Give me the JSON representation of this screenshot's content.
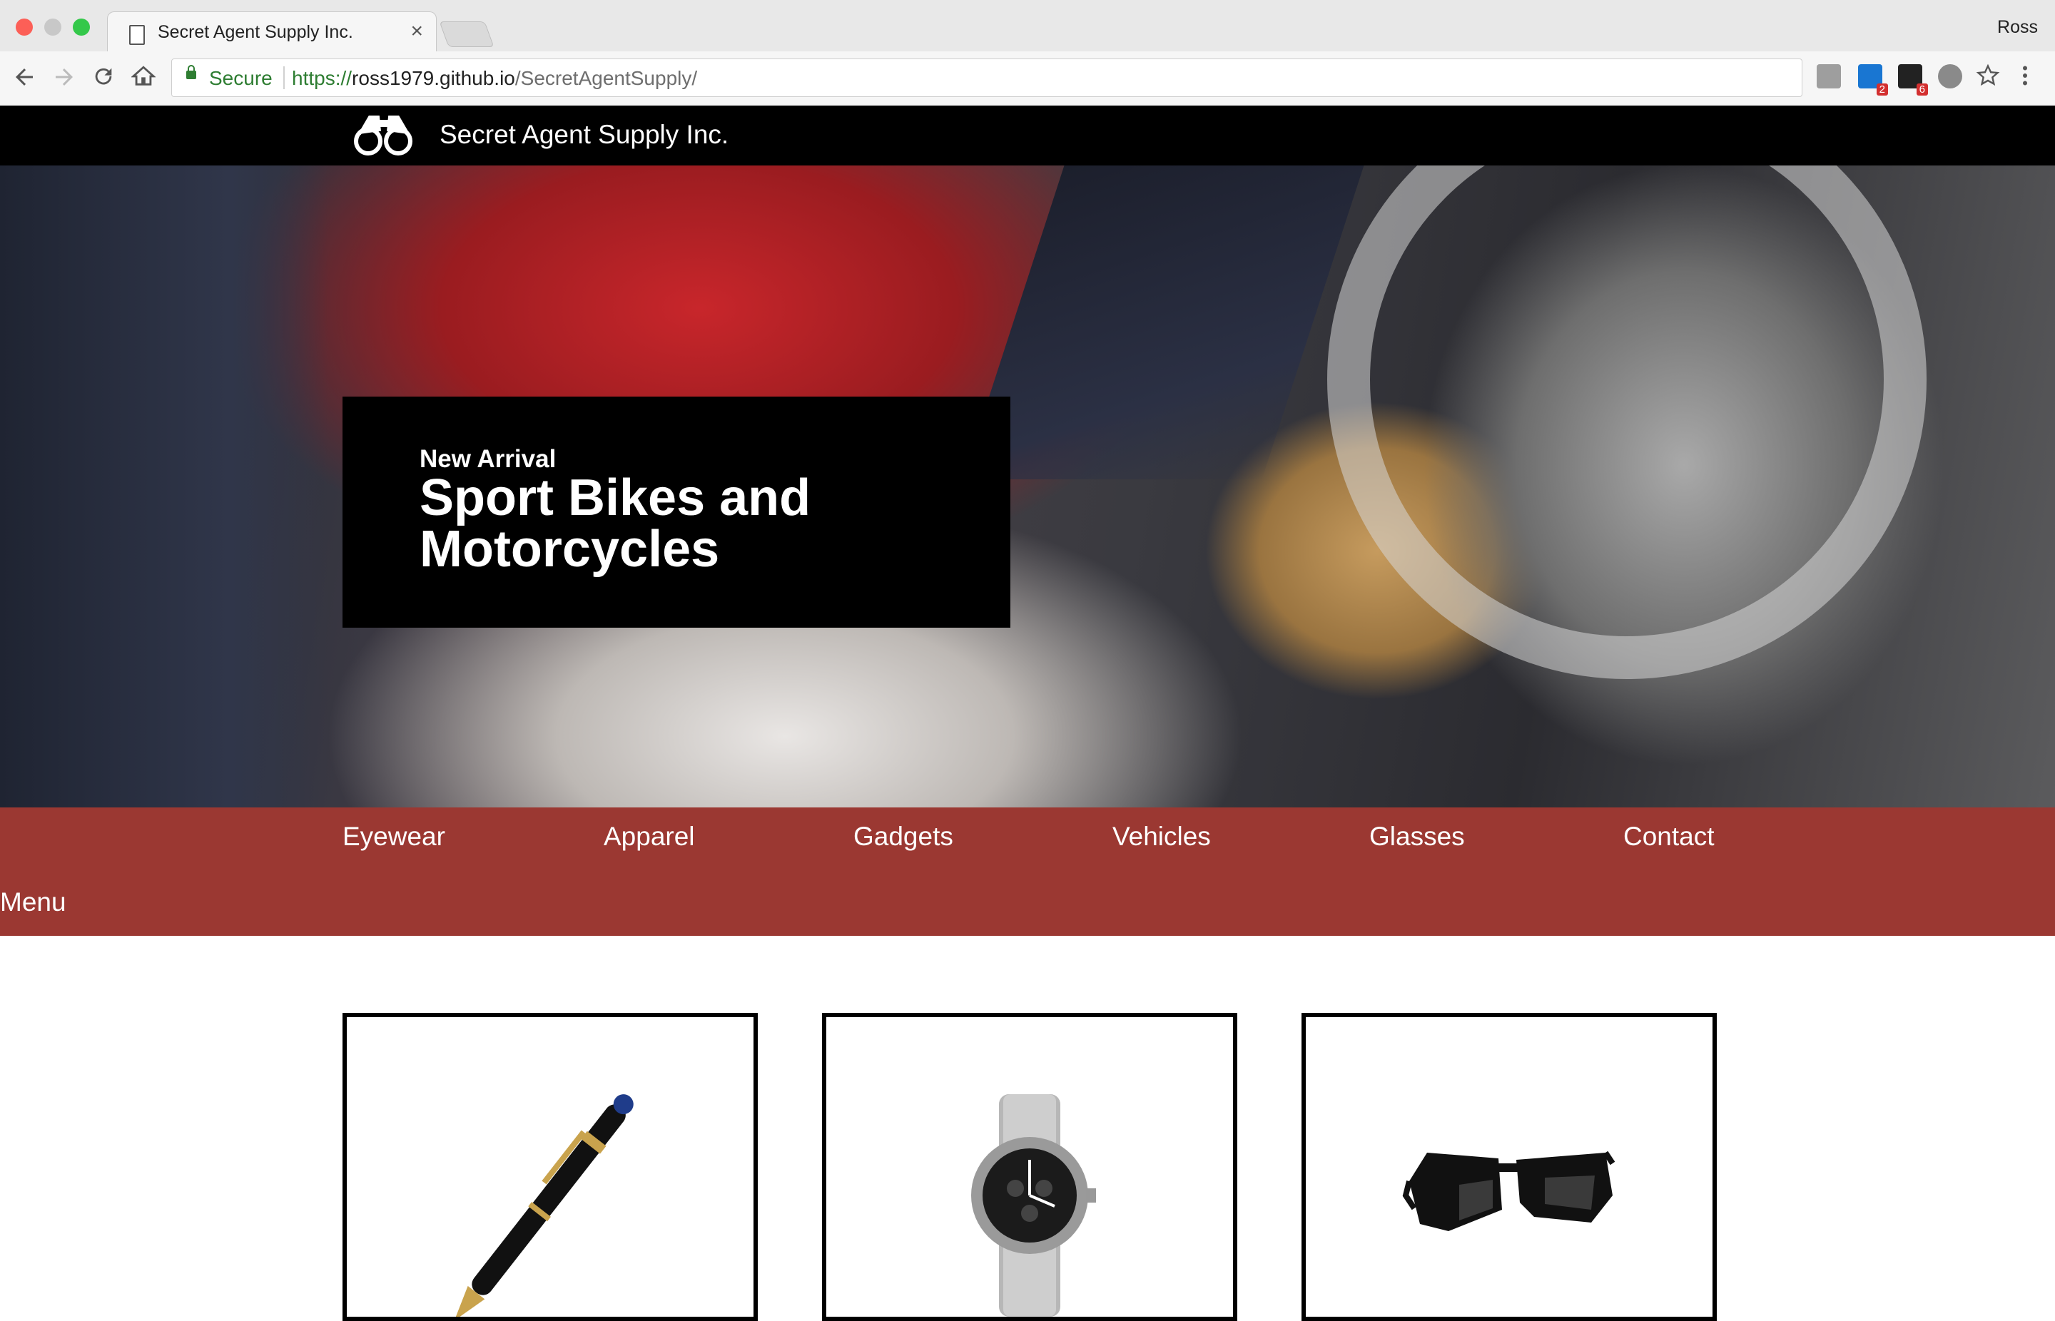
{
  "browser": {
    "tab_title": "Secret Agent Supply Inc.",
    "tab_close": "×",
    "profile_name": "Ross",
    "secure_label": "Secure",
    "url_protocol": "https://",
    "url_host": "ross1979.github.io",
    "url_path": "/SecretAgentSupply/",
    "extensions": [
      {
        "icon": "shield-extension-icon"
      },
      {
        "icon": "linkedin-extension-icon",
        "badge": "2"
      },
      {
        "icon": "extension-icon",
        "badge": "6"
      },
      {
        "icon": "bulb-extension-icon"
      }
    ]
  },
  "site": {
    "title": "Secret Agent Supply Inc."
  },
  "hero": {
    "kicker": "New Arrival",
    "title": "Sport Bikes and Motorcycles"
  },
  "nav": {
    "items": [
      "Eyewear",
      "Apparel",
      "Gadgets",
      "Vehicles",
      "Glasses",
      "Contact"
    ],
    "menu_label": "Menu"
  },
  "products": [
    {
      "image": "pen"
    },
    {
      "image": "watch"
    },
    {
      "image": "sunglasses"
    }
  ],
  "colors": {
    "header_bg": "#000000",
    "nav_bg": "#9b3832",
    "secure_green": "#2e7d32"
  }
}
